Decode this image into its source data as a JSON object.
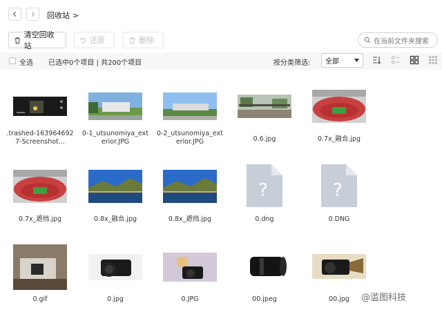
{
  "nav": {
    "back_icon": "chevron-left-icon",
    "forward_icon": "chevron-right-icon"
  },
  "breadcrumb": {
    "current": "回收站",
    "separator": ">"
  },
  "toolbar": {
    "empty_label": "清空回收站",
    "restore_label": "还原",
    "delete_label": "删除"
  },
  "search": {
    "placeholder": "在当前文件夹搜索"
  },
  "subbar": {
    "select_all": "全选",
    "status": "已选中0个项目 | 共200个项目",
    "filter_label": "按分类筛选:",
    "filter_value": "全部"
  },
  "files": [
    {
      "name": ".trashed-1639646927-Screenshot...",
      "kind": "image"
    },
    {
      "name": "0-1_utsunomiya_exterior.JPG",
      "kind": "image"
    },
    {
      "name": "0-2_utsunomiya_exterior.JPG",
      "kind": "image"
    },
    {
      "name": "0.6.jpg",
      "kind": "image"
    },
    {
      "name": "0.7x_融合.jpg",
      "kind": "image"
    },
    {
      "name": "0.7x_遮挡.jpg",
      "kind": "image"
    },
    {
      "name": "0.8x_融合.jpg",
      "kind": "image"
    },
    {
      "name": "0.8x_遮挡.jpg",
      "kind": "image"
    },
    {
      "name": "0.dng",
      "kind": "unknown"
    },
    {
      "name": "0.DNG",
      "kind": "unknown"
    },
    {
      "name": "0.gif",
      "kind": "image"
    },
    {
      "name": "0.jpg",
      "kind": "image"
    },
    {
      "name": "0.JPG",
      "kind": "image"
    },
    {
      "name": "00.jpeg",
      "kind": "image"
    },
    {
      "name": "00.jpg",
      "kind": "image"
    }
  ],
  "watermark": "@滥图科技",
  "colors": {
    "accent": "#ffffff",
    "disabled_text": "#c2c2c2",
    "doc_icon": "#c8ced8"
  }
}
